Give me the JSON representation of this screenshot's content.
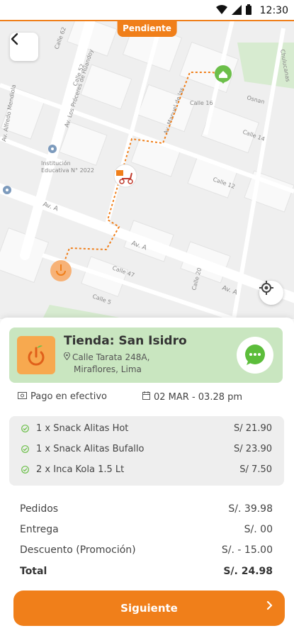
{
  "status_bar": {
    "time": "12:30",
    "icons": [
      "wifi-icon",
      "signal-icon",
      "battery-icon"
    ]
  },
  "order_status": "Pendiente",
  "map": {
    "street_labels": [
      "Calle 62",
      "Av. Los Próceres de Huandoy",
      "Calle 52",
      "Calle 16",
      "Calle 14",
      "Calle 12",
      "Calle 47",
      "Calle 5",
      "Calle 20",
      "Av. A",
      "Av. A",
      "Av. Alfredo Mendiola",
      "Av. A",
      "Osnan",
      "Chulucanas",
      "Av. Manuel de las"
    ],
    "poi_label_line1": "Institución",
    "poi_label_line2": "Educativa N° 2022"
  },
  "store": {
    "name": "Tienda: San Isidro",
    "address_line1": "Calle Tarata 248A,",
    "address_line2": "Miraflores, Lima"
  },
  "payment": {
    "method": "Pago en efectivo",
    "datetime": "02 MAR - 03.28 pm"
  },
  "items": [
    {
      "name": "1 x Snack Alitas Hot",
      "price": "S/ 21.90"
    },
    {
      "name": "1 x Snack Alitas Bufallo",
      "price": "S/ 23.90"
    },
    {
      "name": "2 x Inca Kola 1.5 Lt",
      "price": "S/ 7.50"
    }
  ],
  "totals": [
    {
      "label": "Pedidos",
      "value": "S/. 39.98"
    },
    {
      "label": "Entrega",
      "value": "S/. 00"
    },
    {
      "label": "Descuento (Promoción)",
      "value": "S/. - 15.00"
    },
    {
      "label": "Total",
      "value": "S/. 24.98"
    }
  ],
  "next_label": "Siguiente",
  "colors": {
    "accent": "#f07f1a",
    "store_card": "#c9e6c0",
    "check": "#6cbf4a",
    "map_bg": "#efefef"
  }
}
